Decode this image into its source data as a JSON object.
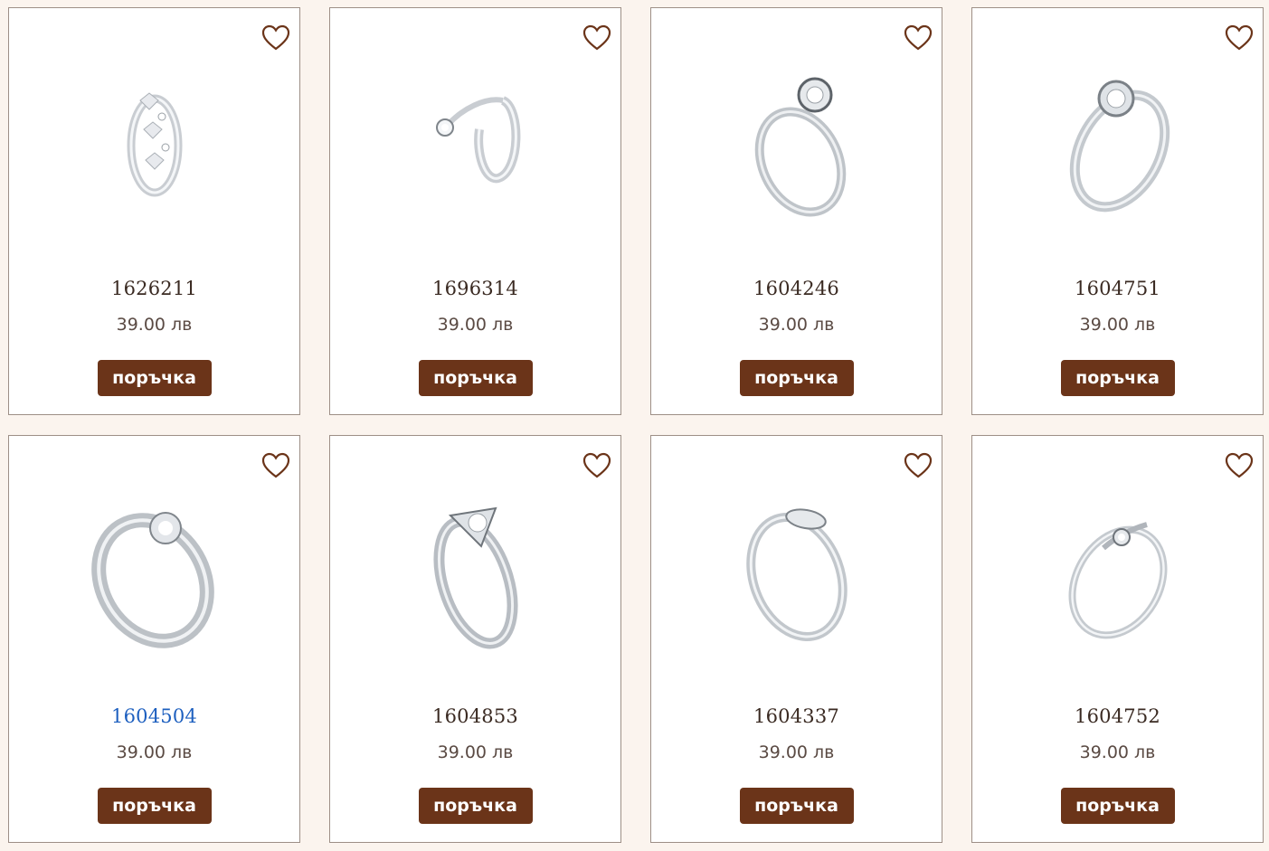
{
  "colors": {
    "background": "#fbf4ee",
    "card_border": "#9d8f86",
    "button_bg": "#6b3419",
    "heart": "#6b3419",
    "code_text": "#3a2a22",
    "code_link": "#1d5fbf",
    "price_text": "#5a4a43"
  },
  "products": [
    {
      "code": "1626211",
      "price": "39.00 лв",
      "button": "поръчка",
      "icon": "heart-outline-icon",
      "image": "silver-ring-hearts"
    },
    {
      "code": "1696314",
      "price": "39.00 лв",
      "button": "поръчка",
      "icon": "heart-outline-icon",
      "image": "silver-ring-open-stone"
    },
    {
      "code": "1604246",
      "price": "39.00 лв",
      "button": "поръчка",
      "icon": "heart-outline-icon",
      "image": "silver-ring-solitaire"
    },
    {
      "code": "1604751",
      "price": "39.00 лв",
      "button": "поръчка",
      "icon": "heart-outline-icon",
      "image": "silver-ring-bezel"
    },
    {
      "code": "1604504",
      "price": "39.00 лв",
      "button": "поръчка",
      "icon": "heart-outline-icon",
      "image": "silver-ring-wide-stone"
    },
    {
      "code": "1604853",
      "price": "39.00 лв",
      "button": "поръчка",
      "icon": "heart-outline-icon",
      "image": "silver-ring-v-stone"
    },
    {
      "code": "1604337",
      "price": "39.00 лв",
      "button": "поръчка",
      "icon": "heart-outline-icon",
      "image": "silver-ring-marquise"
    },
    {
      "code": "1604752",
      "price": "39.00 лв",
      "button": "поръчка",
      "icon": "heart-outline-icon",
      "image": "silver-ring-bypass"
    }
  ]
}
